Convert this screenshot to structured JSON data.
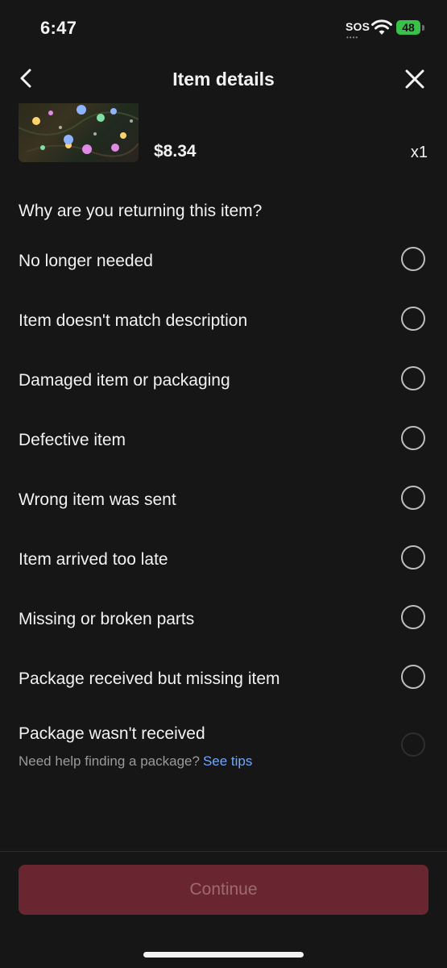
{
  "status_bar": {
    "time": "6:47",
    "sos": "SOS",
    "battery": "48"
  },
  "header": {
    "title": "Item details",
    "back_icon": "chevron-left-icon",
    "close_icon": "close-icon"
  },
  "product": {
    "price": "$8.34",
    "quantity": "x1"
  },
  "question": "Why are you returning this item?",
  "reasons": [
    {
      "label": "No longer needed"
    },
    {
      "label": "Item doesn't match description"
    },
    {
      "label": "Damaged item or packaging"
    },
    {
      "label": "Defective item"
    },
    {
      "label": "Wrong item was sent"
    },
    {
      "label": "Item arrived too late"
    },
    {
      "label": "Missing or broken parts"
    },
    {
      "label": "Package received but missing item"
    },
    {
      "label": "Package wasn't received"
    }
  ],
  "help": {
    "text": "Need help finding a package?",
    "link": "See tips"
  },
  "continue_label": "Continue",
  "colors": {
    "background": "#161616",
    "button": "#6a2630",
    "link": "#6ea8ff",
    "battery": "#3ac14a"
  }
}
